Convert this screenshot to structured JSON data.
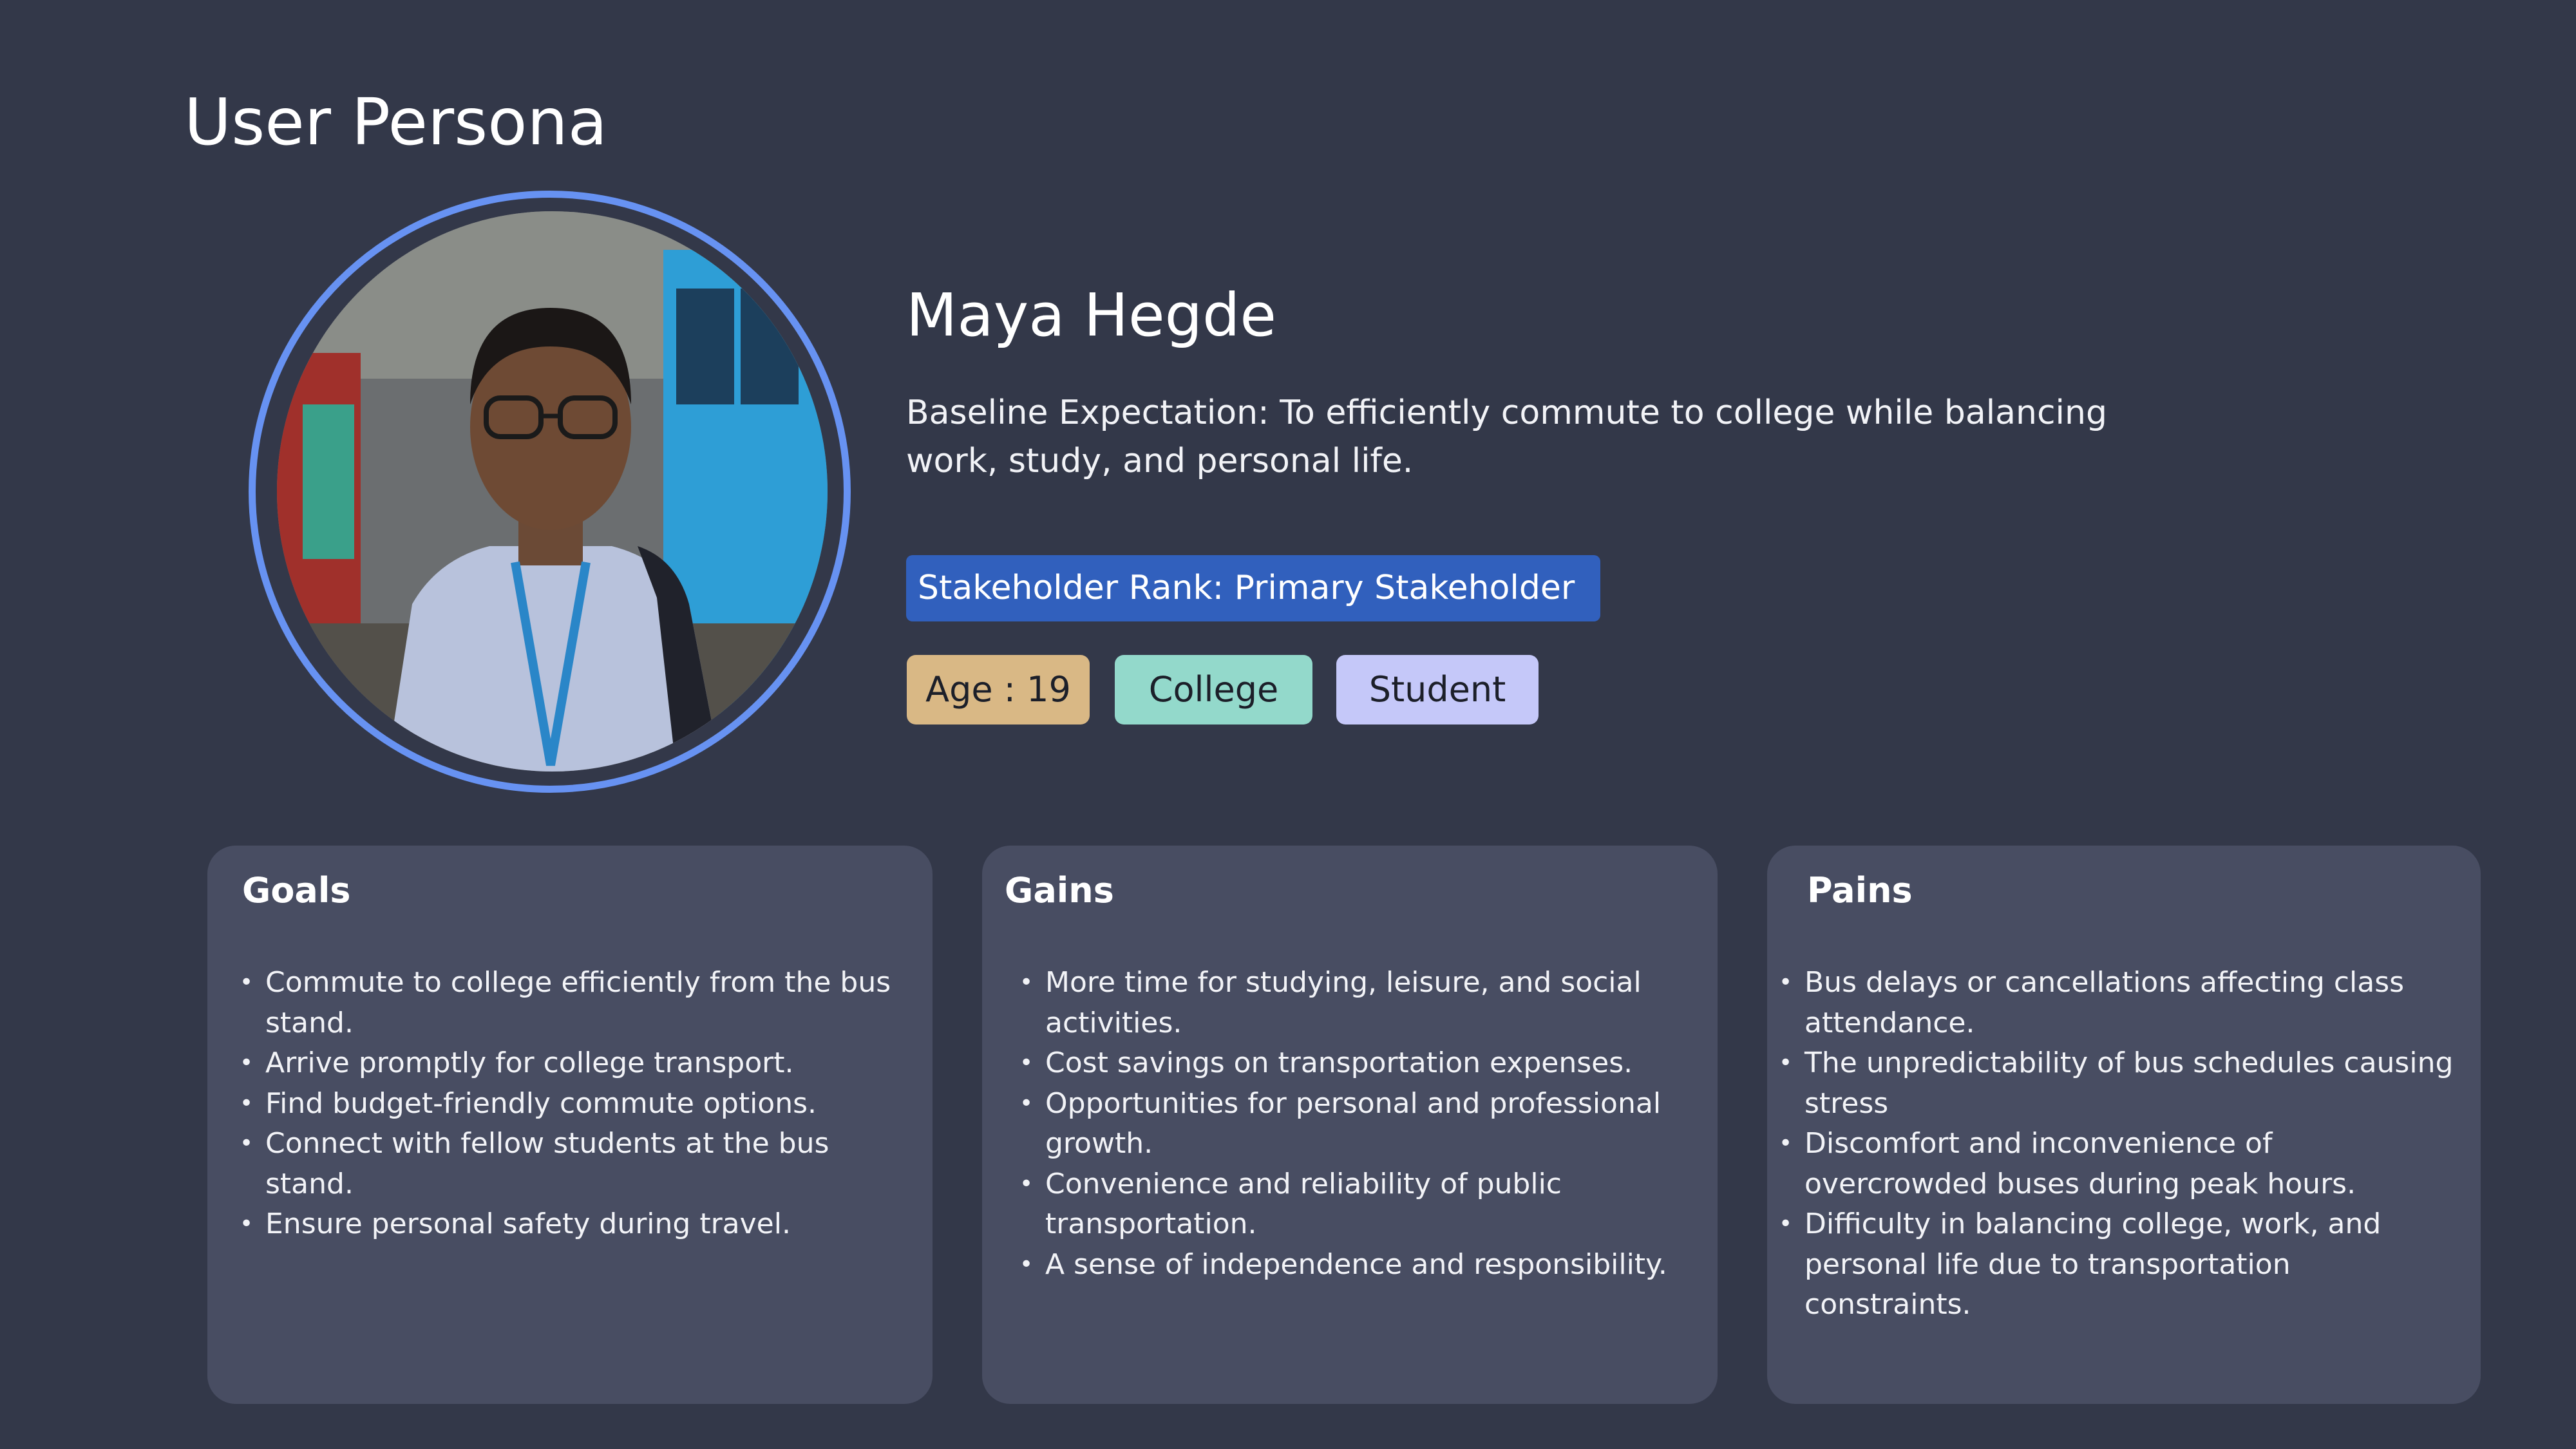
{
  "page": {
    "title": "User Persona"
  },
  "persona": {
    "name": "Maya Hegde",
    "baseline": "Baseline Expectation: To efficiently commute to college while balancing work, study, and personal life.",
    "rank": "Stakeholder Rank: Primary Stakeholder",
    "tags": [
      "Age : 19",
      "College",
      "Student"
    ]
  },
  "cards": [
    {
      "title": "Goals",
      "items": [
        "Commute to college efficiently from the bus stand.",
        "Arrive promptly for college transport.",
        "Find budget-friendly commute options.",
        "Connect with fellow students at the bus stand.",
        "Ensure personal safety during travel."
      ]
    },
    {
      "title": "Gains",
      "items": [
        "More time for studying, leisure, and social activities.",
        "Cost savings on transportation expenses.",
        "Opportunities for personal and professional growth.",
        "Convenience and reliability of public transportation.",
        "A sense of independence and responsibility."
      ]
    },
    {
      "title": "Pains",
      "items": [
        "Bus delays or cancellations affecting class attendance.",
        "The unpredictability of bus schedules causing stress",
        "Discomfort and inconvenience of overcrowded buses during peak hours.",
        "Difficulty in balancing college, work, and personal life due to transportation constraints."
      ]
    }
  ],
  "colors": {
    "background": "#333849",
    "card": "#484d62",
    "ring": "#6792f2",
    "rank_chip": "#3160bd",
    "tag_age": "#d9b885",
    "tag_college": "#93d9cb",
    "tag_student": "#c5c8f9"
  },
  "icons": {
    "avatar": "persona-photo"
  }
}
